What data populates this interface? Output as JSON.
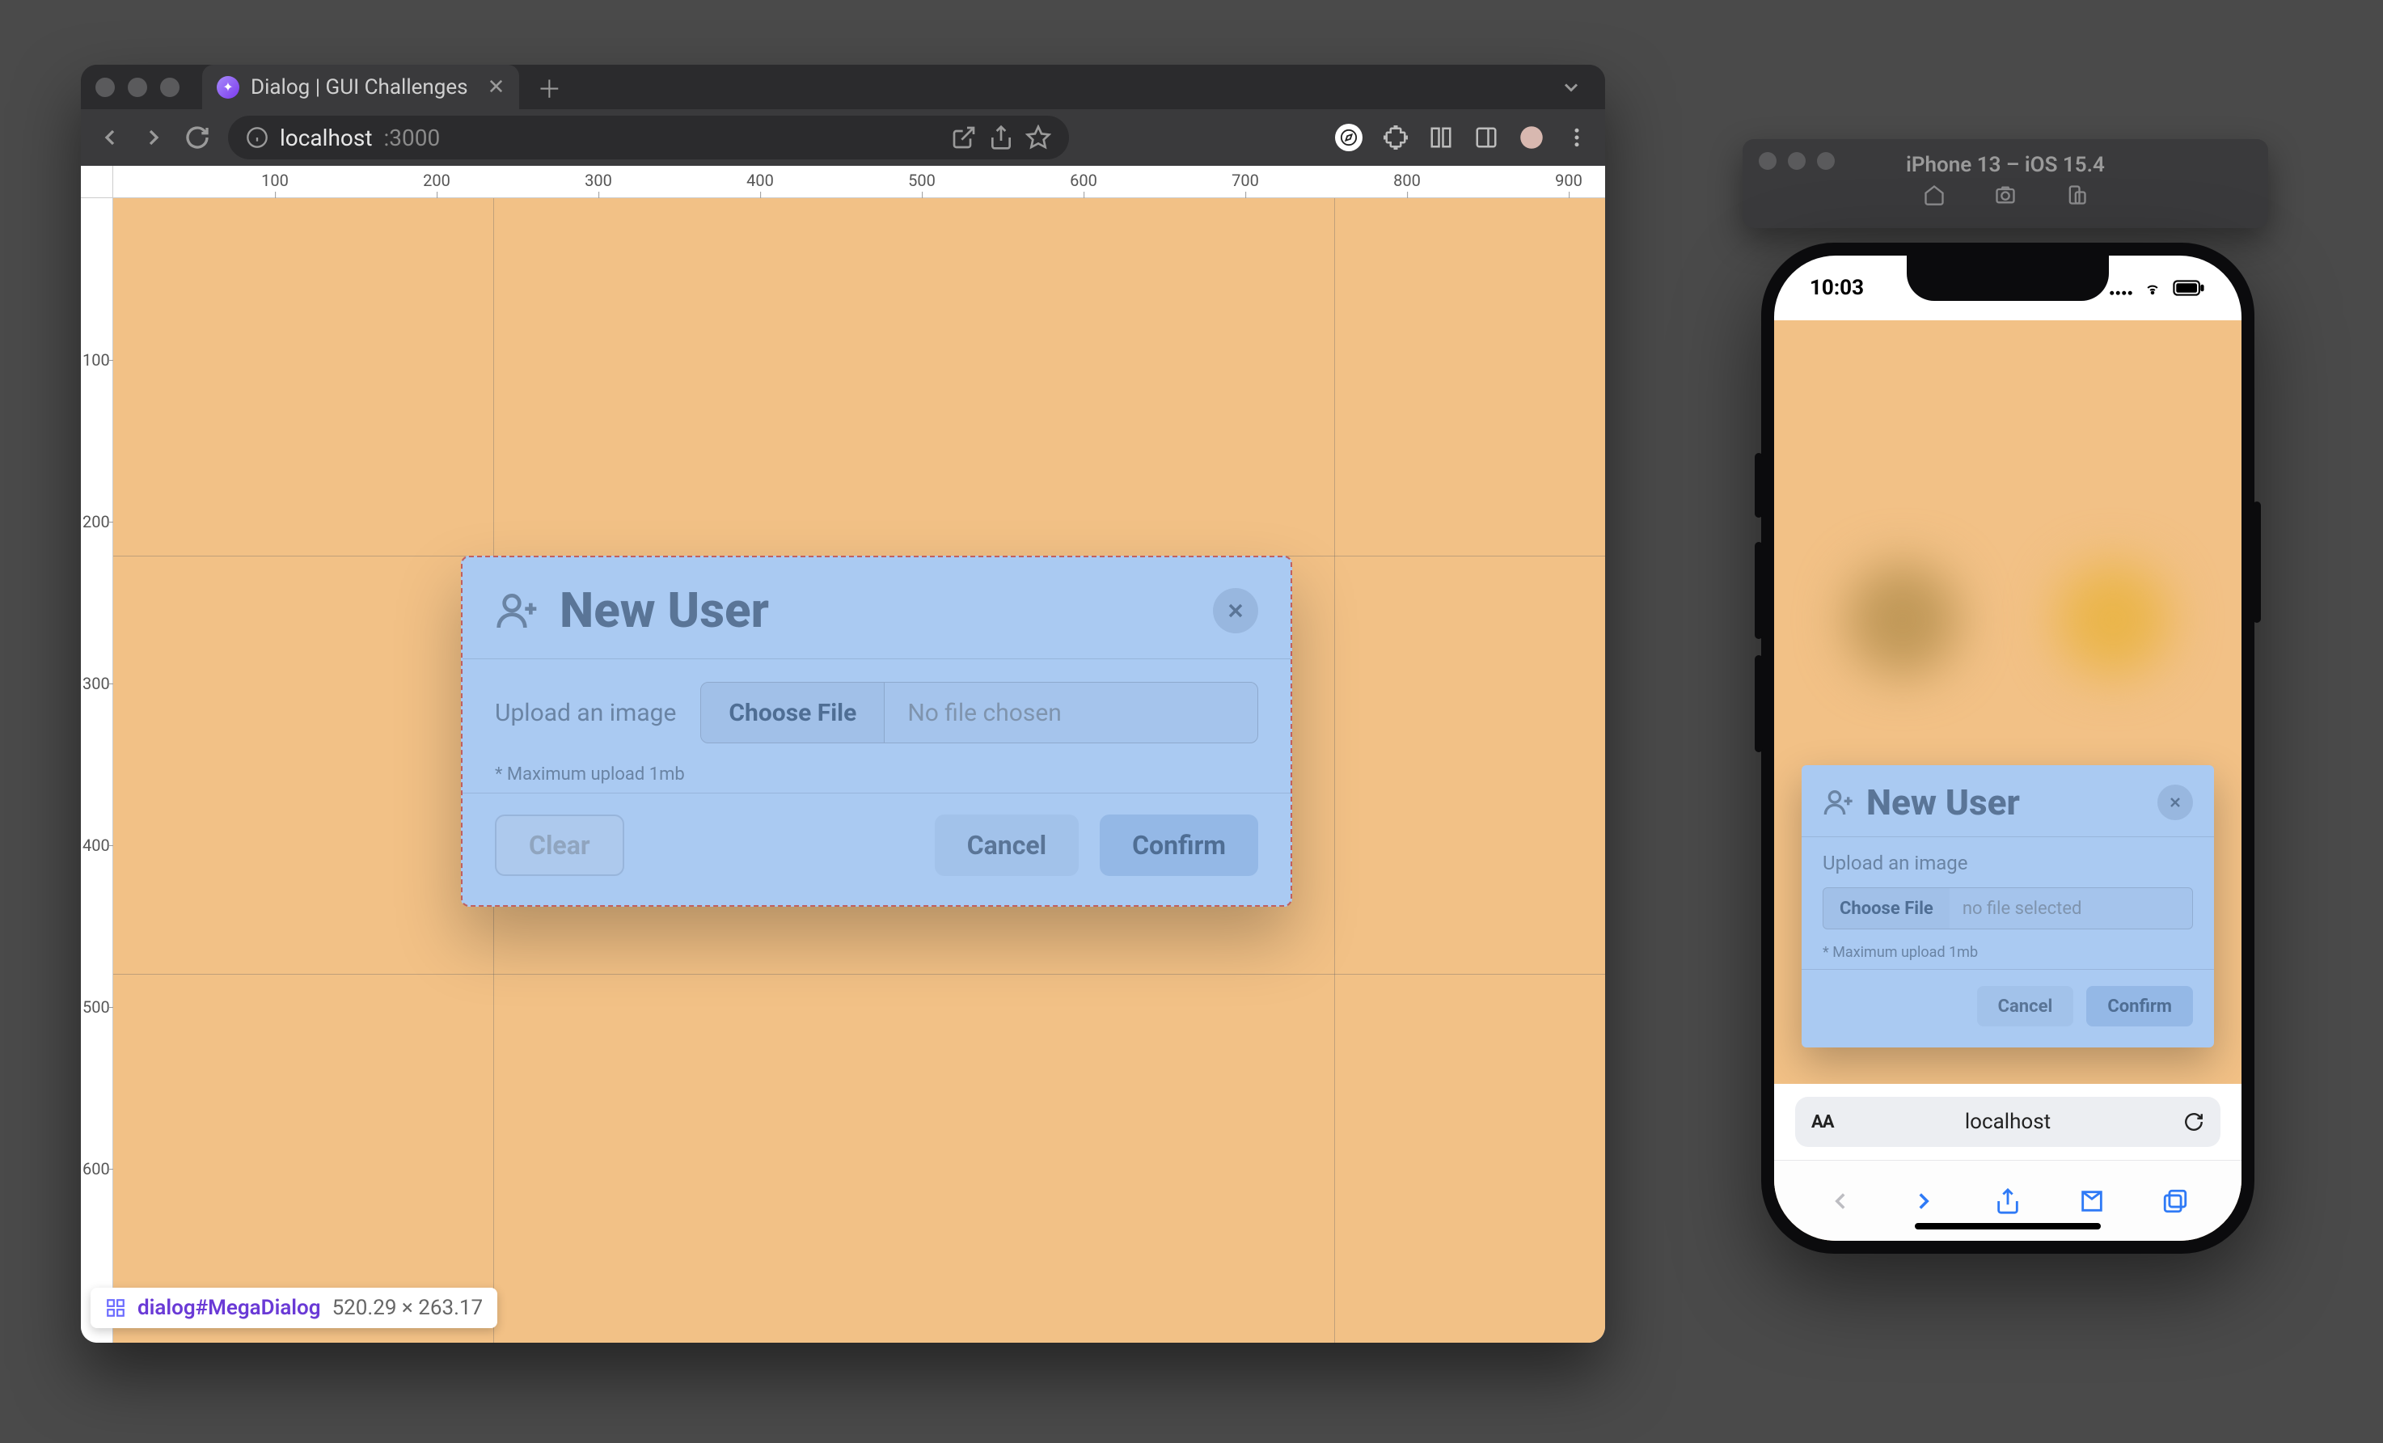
{
  "browser": {
    "tab_title": "Dialog | GUI Challenges",
    "address": {
      "host": "localhost",
      "port": ":3000"
    },
    "ruler_h": [
      "100",
      "200",
      "300",
      "400",
      "500",
      "600",
      "700",
      "800",
      "900"
    ],
    "ruler_v": [
      "100",
      "200",
      "300",
      "400",
      "500",
      "600"
    ],
    "guides": {
      "v": [
        470,
        1510
      ],
      "h": [
        442,
        959
      ]
    },
    "element_inspector": {
      "selector": "dialog#MegaDialog",
      "dimensions": "520.29 × 263.17"
    }
  },
  "dialog": {
    "title": "New User",
    "upload_label": "Upload an image",
    "choose_file": "Choose File",
    "no_file": "No file chosen",
    "hint": "* Maximum upload 1mb",
    "clear": "Clear",
    "cancel": "Cancel",
    "confirm": "Confirm"
  },
  "simulator": {
    "title": "iPhone 13 – iOS 15.4",
    "status_time": "10:03",
    "safari_host": "localhost"
  },
  "mobile_dialog": {
    "title": "New User",
    "upload_label": "Upload an image",
    "choose_file": "Choose File",
    "no_file": "no file selected",
    "hint": "* Maximum upload 1mb",
    "cancel": "Cancel",
    "confirm": "Confirm"
  }
}
